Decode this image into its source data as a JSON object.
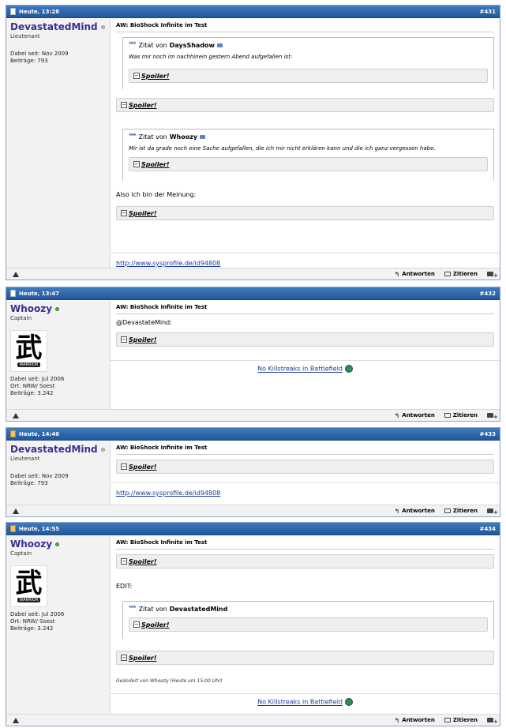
{
  "posts": [
    {
      "date": "Heute, 13:28",
      "number": "#431",
      "username": "DevastatedMind",
      "rank": "Lieutenant",
      "stats": [
        "Dabei seit: Nov 2009",
        "Beiträge: 793"
      ],
      "title": "AW: BioShock Infinite im Test",
      "quote1": {
        "prefix": "Zitat von",
        "author": "DaysShadow",
        "text": "Was mir noch im nachhinein gestern Abend aufgefallen ist:"
      },
      "quote2": {
        "prefix": "Zitat von",
        "author": "Whoozy",
        "text": "Mir ist da grade noch eine Sache aufgefallen, die ich mir nicht erklären kann und die ich ganz vergessen habe."
      },
      "text1": "Also ich bin der Meinung:",
      "signature": "http://www.sysprofile.de/id94808"
    },
    {
      "date": "Heute, 13:47",
      "number": "#432",
      "username": "Whoozy",
      "rank": "Captain",
      "avatar_text": "武",
      "avatar_banner": "WARRIOR",
      "stats": [
        "Dabei seit: Jul 2006",
        "Ort: NRW/ Soest",
        "Beiträge: 3.242"
      ],
      "title": "AW: BioShock Infinite im Test",
      "text1": "@DevastateMind:",
      "signature": "No Killstreaks in Battlefield"
    },
    {
      "date": "Heute, 14:46",
      "number": "#433",
      "username": "DevastatedMind",
      "rank": "Lieutenant",
      "stats": [
        "Dabei seit: Nov 2009",
        "Beiträge: 793"
      ],
      "title": "AW: BioShock Infinite im Test",
      "signature": "http://www.sysprofile.de/id94808"
    },
    {
      "date": "Heute, 14:55",
      "number": "#434",
      "username": "Whoozy",
      "rank": "Captain",
      "avatar_text": "武",
      "avatar_banner": "WARRIOR",
      "stats": [
        "Dabei seit: Jul 2006",
        "Ort: NRW/ Soest",
        "Beiträge: 3.242"
      ],
      "title": "AW: BioShock Infinite im Test",
      "text1": "EDIT:",
      "quote1": {
        "prefix": "Zitat von",
        "author": "DevastatedMind"
      },
      "edited": "Geändert von Whoozy (Heute um 15:00 Uhr)",
      "signature": "No Killstreaks in Battlefield"
    }
  ],
  "labels": {
    "spoiler": "Spoiler!",
    "reply": "Antworten",
    "quote": "Zitieren"
  },
  "icons": {
    "post_old": "document-icon",
    "post_new": "document-new-icon",
    "report": "warning-triangle-icon",
    "quote_mark": "quote-icon",
    "view_post": "view-post-icon",
    "reply": "reply-arrow-icon",
    "quote": "quote-bubble-icon",
    "multiquote": "multiquote-plus-icon",
    "online": "online-dot-icon",
    "sig_badge": "battlefield-badge-icon"
  },
  "colors": {
    "header_blue": "#23569a",
    "username": "#3a2f8f",
    "link": "#1a3b9a",
    "online": "#4caf3a"
  }
}
